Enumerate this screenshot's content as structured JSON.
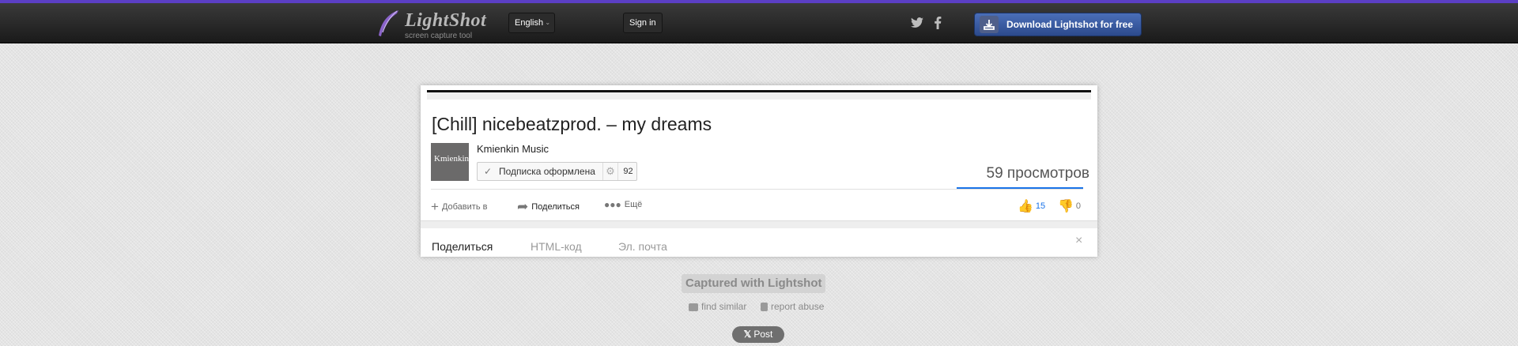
{
  "header": {
    "logo_name": "LightShot",
    "logo_tagline": "screen capture tool",
    "language": "English",
    "sign_in": "Sign in",
    "twitter_icon": "twitter-icon",
    "facebook_icon": "facebook-icon",
    "download_label": "Download Lightshot for free",
    "accent_color": "#5b3fc4"
  },
  "screenshot": {
    "video_title": "[Chill] nicebeatzprod. – my dreams",
    "channel_name": "Kmienkin Music",
    "avatar_text": "Kmienkin",
    "subscribe_label": "Подписка оформлена",
    "subscriber_count": "92",
    "views": "59 просмотров",
    "actions": {
      "add_to": "Добавить в",
      "share": "Поделиться",
      "more": "Ещё"
    },
    "likes": "15",
    "dislikes": "0",
    "share_tabs": [
      "Поделиться",
      "HTML-код",
      "Эл. почта"
    ]
  },
  "footer": {
    "captured": "Captured with Lightshot",
    "find_similar": "find similar",
    "report_abuse": "report abuse",
    "post": "Post"
  }
}
